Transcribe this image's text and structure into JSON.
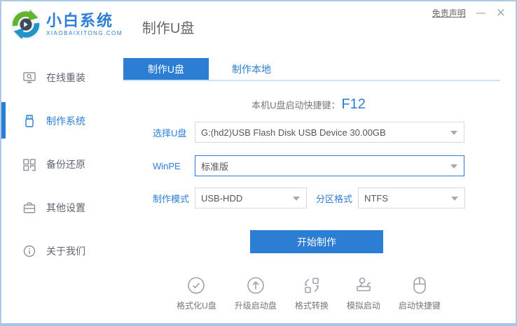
{
  "window": {
    "disclaimer": "免责声明",
    "minimize": "—",
    "close": "×"
  },
  "brand": {
    "name": "小白系统",
    "domain": "XIAOBAIXITONG.COM"
  },
  "header": {
    "page_title": "制作U盘"
  },
  "sidebar": {
    "items": [
      {
        "label": "在线重装",
        "icon": "monitor-search-icon",
        "active": false
      },
      {
        "label": "制作系统",
        "icon": "usb-drive-icon",
        "active": true
      },
      {
        "label": "备份还原",
        "icon": "backup-grid-icon",
        "active": false
      },
      {
        "label": "其他设置",
        "icon": "toolbox-icon",
        "active": false
      },
      {
        "label": "关于我们",
        "icon": "info-circle-icon",
        "active": false
      }
    ]
  },
  "tabs": [
    {
      "label": "制作U盘",
      "active": true
    },
    {
      "label": "制作本地",
      "active": false
    }
  ],
  "hotkey": {
    "prefix": "本机U盘启动快捷键：",
    "key": "F12"
  },
  "form": {
    "usb": {
      "label": "选择U盘",
      "value": "G:(hd2)USB Flash Disk USB Device 30.00GB"
    },
    "winpe": {
      "label": "WinPE",
      "value": "标准版"
    },
    "mode": {
      "label": "制作模式",
      "value": "USB-HDD"
    },
    "partition": {
      "label": "分区格式",
      "value": "NTFS"
    }
  },
  "start_button": "开始制作",
  "tools": [
    {
      "label": "格式化U盘",
      "icon": "check-circle-icon"
    },
    {
      "label": "升级启动盘",
      "icon": "arrow-up-circle-icon"
    },
    {
      "label": "格式转换",
      "icon": "convert-icon"
    },
    {
      "label": "模拟启动",
      "icon": "stamp-icon"
    },
    {
      "label": "启动快捷键",
      "icon": "mouse-icon"
    }
  ],
  "colors": {
    "primary": "#2b7ed3",
    "window_border": "#abc9e9",
    "tab_underline": "#cfe2f4",
    "logo_green": "#63b42d",
    "logo_blue": "#2494c6",
    "logo_dark": "#3d4a59"
  }
}
